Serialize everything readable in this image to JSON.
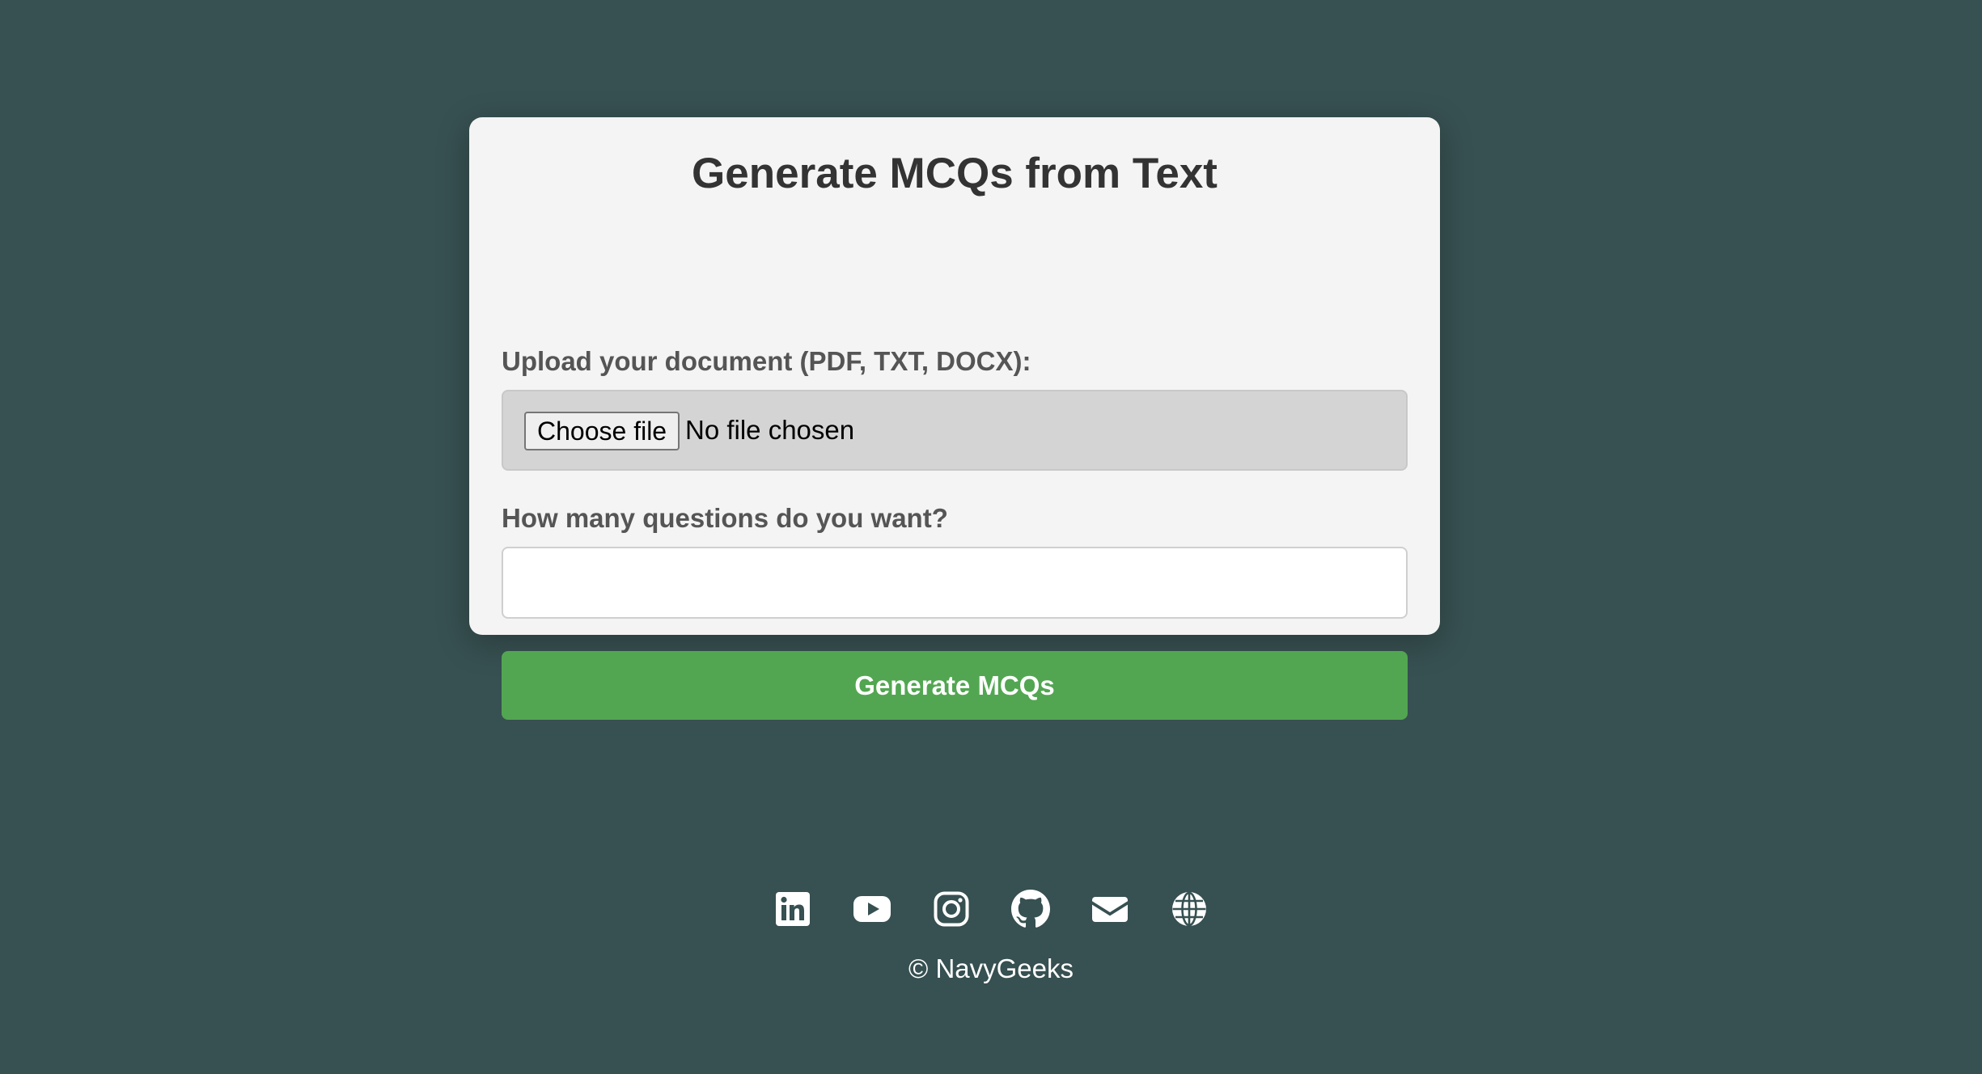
{
  "form": {
    "title": "Generate MCQs from Text",
    "upload_label": "Upload your document (PDF, TXT, DOCX):",
    "choose_file_label": "Choose file",
    "file_status": "No file chosen",
    "count_label": "How many questions do you want?",
    "count_value": "",
    "submit_label": "Generate MCQs"
  },
  "footer": {
    "social_icons": [
      "linkedin-icon",
      "youtube-icon",
      "instagram-icon",
      "github-icon",
      "email-icon",
      "globe-icon"
    ],
    "copyright": "© NavyGeeks"
  },
  "colors": {
    "background": "#375051",
    "card": "#f4f4f4",
    "accent_button": "#52a651",
    "file_box": "#d4d4d4",
    "text_dark": "#333333",
    "label_text": "#555555"
  }
}
